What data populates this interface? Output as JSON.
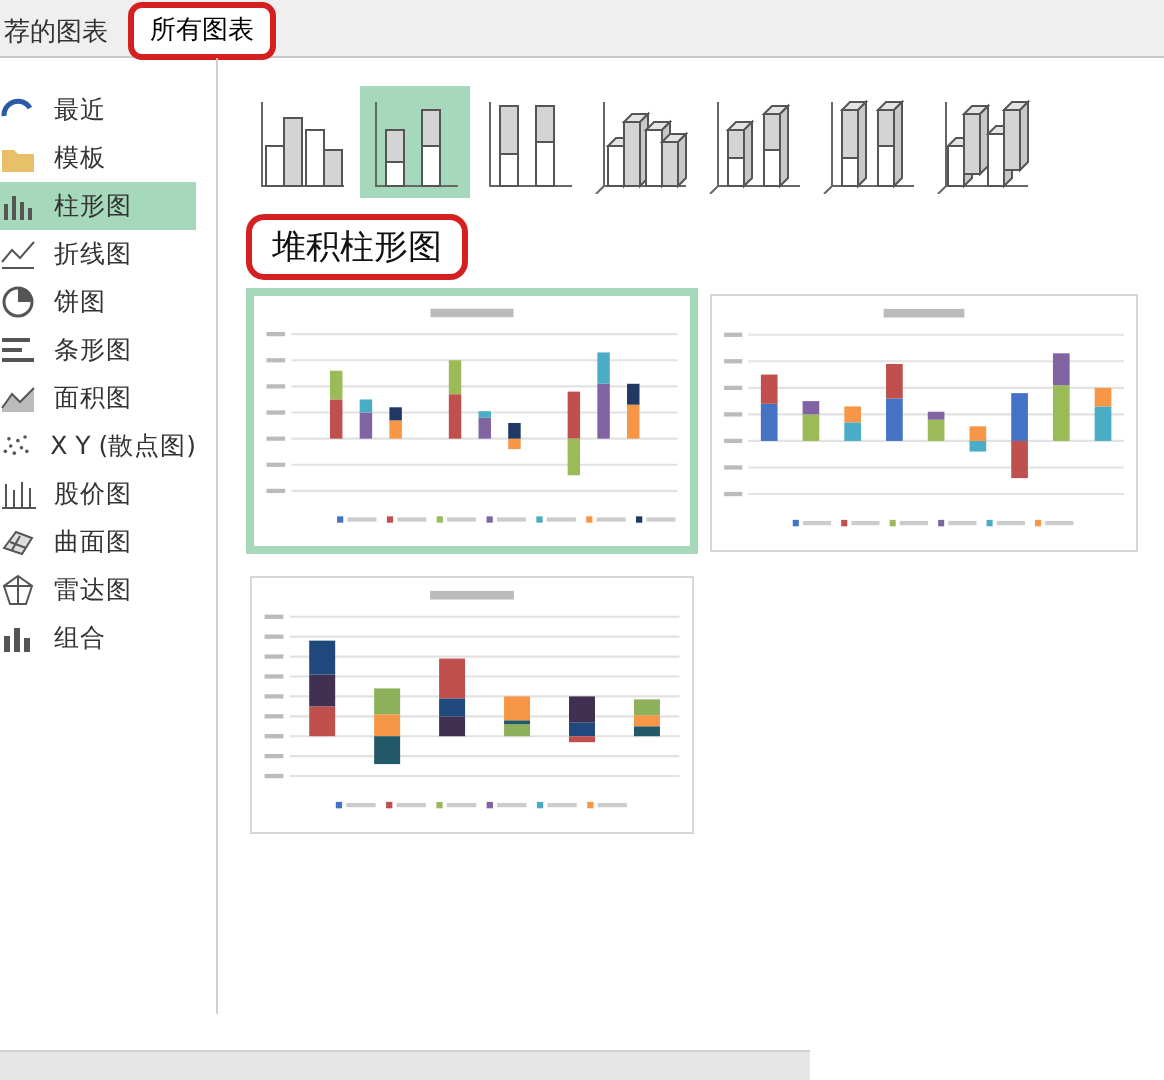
{
  "tabs": [
    {
      "label": "荐的图表",
      "selected": false,
      "highlighted": false
    },
    {
      "label": "所有图表",
      "selected": true,
      "highlighted": true
    }
  ],
  "sidebar": {
    "items": [
      {
        "label": "最近",
        "kind": "recent",
        "selected": false
      },
      {
        "label": "模板",
        "kind": "template",
        "selected": false
      },
      {
        "label": "柱形图",
        "kind": "column",
        "selected": true
      },
      {
        "label": "折线图",
        "kind": "line",
        "selected": false
      },
      {
        "label": "饼图",
        "kind": "pie",
        "selected": false
      },
      {
        "label": "条形图",
        "kind": "bar",
        "selected": false
      },
      {
        "label": "面积图",
        "kind": "area",
        "selected": false
      },
      {
        "label": "X Y (散点图)",
        "kind": "scatter",
        "selected": false
      },
      {
        "label": "股价图",
        "kind": "stock",
        "selected": false
      },
      {
        "label": "曲面图",
        "kind": "surface",
        "selected": false
      },
      {
        "label": "雷达图",
        "kind": "radar",
        "selected": false
      },
      {
        "label": "组合",
        "kind": "combo",
        "selected": false
      }
    ]
  },
  "subtypes": [
    {
      "kind": "clustered",
      "selected": false
    },
    {
      "kind": "stacked",
      "selected": true
    },
    {
      "kind": "stacked100",
      "selected": false
    },
    {
      "kind": "clustered3d",
      "selected": false
    },
    {
      "kind": "stacked3d",
      "selected": false
    },
    {
      "kind": "stacked100_3d",
      "selected": false
    },
    {
      "kind": "column3d",
      "selected": false
    }
  ],
  "heading": {
    "text": "堆积柱形图",
    "highlighted": true
  },
  "previews": [
    {
      "kind": "months",
      "selected": true
    },
    {
      "kind": "groups",
      "selected": false
    },
    {
      "kind": "series",
      "selected": false
    }
  ]
}
